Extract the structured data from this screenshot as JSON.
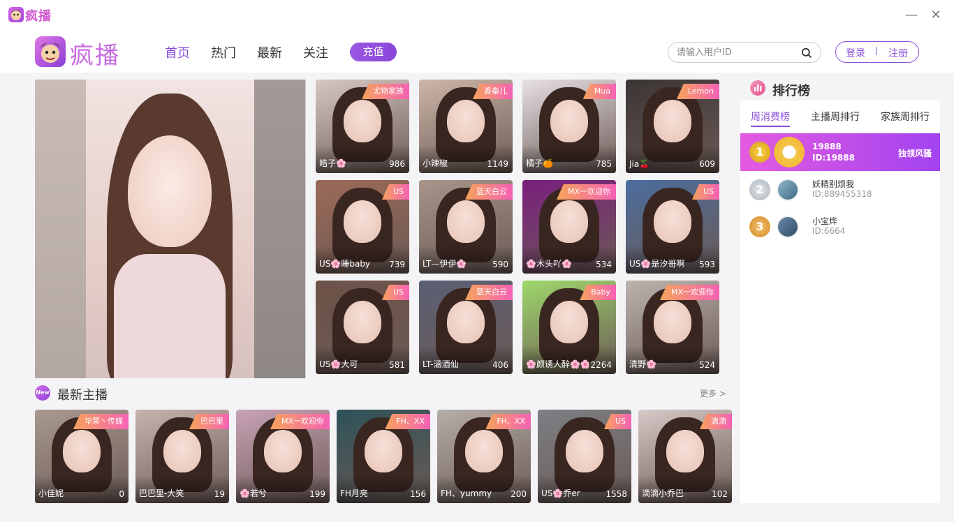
{
  "window": {
    "title": "疯播",
    "minimize_glyph": "—",
    "close_glyph": "✕"
  },
  "header": {
    "logo_text": "疯播",
    "nav": [
      {
        "label": "首页",
        "active": true
      },
      {
        "label": "热门",
        "active": false
      },
      {
        "label": "最新",
        "active": false
      },
      {
        "label": "关注",
        "active": false
      }
    ],
    "charge_label": "充值",
    "search_placeholder": "请输入用户ID",
    "login_label": "登录",
    "register_label": "注册"
  },
  "featured_grid": [
    {
      "tag": "尤物家族",
      "name": "皓子🌸",
      "count": "986",
      "bg": "#d8c8c4"
    },
    {
      "tag": "香秦儿",
      "name": "小辣椒",
      "count": "1149",
      "bg": "#cdb6a8"
    },
    {
      "tag": "Mua",
      "name": "橘子🍊",
      "count": "785",
      "bg": "#e7e0e4"
    },
    {
      "tag": "Lemon",
      "name": "Jia🍒",
      "count": "609",
      "bg": "#3b3535"
    },
    {
      "tag": "US",
      "name": "US🌸睡baby",
      "count": "739",
      "bg": "#9c6a58"
    },
    {
      "tag": "蓝天白云",
      "name": "LT—伊伊🌸",
      "count": "590",
      "bg": "#a8958a"
    },
    {
      "tag": "MX一欢迎你",
      "name": "🌸木头吖🌸",
      "count": "534",
      "bg": "#7a1f7d"
    },
    {
      "tag": "US",
      "name": "US🌸是汐哥啊",
      "count": "593",
      "bg": "#4b6d9e"
    },
    {
      "tag": "US",
      "name": "US🌸大可",
      "count": "581",
      "bg": "#6d5248"
    },
    {
      "tag": "蓝天白云",
      "name": "LT-涵酒仙",
      "count": "406",
      "bg": "#5a5f74"
    },
    {
      "tag": "Baby",
      "name": "🌸颜诱人醉🌸🌸",
      "count": "2264",
      "bg": "#9fd86c"
    },
    {
      "tag": "MX一欢迎你",
      "name": "清野🌸",
      "count": "524",
      "bg": "#bcb3ae"
    }
  ],
  "new_section": {
    "title": "最新主播",
    "icon_text": "New",
    "more_label": "更多 >"
  },
  "new_anchors": [
    {
      "tag": "华荣丶传媒",
      "name": "小佳妮",
      "count": "0",
      "bg": "#a99a90"
    },
    {
      "tag": "巴巴里",
      "name": "巴巴里-大笑",
      "count": "19",
      "bg": "#c8b3ae"
    },
    {
      "tag": "MX一欢迎你",
      "name": "🌸若兮",
      "count": "199",
      "bg": "#c9a3b6"
    },
    {
      "tag": "FH、XX",
      "name": "FH月亮",
      "count": "156",
      "bg": "#2e5258"
    },
    {
      "tag": "FH、XX",
      "name": "FH、yummy",
      "count": "200",
      "bg": "#b6aea9"
    },
    {
      "tag": "US",
      "name": "US🌸乔er",
      "count": "1558",
      "bg": "#7d7f84"
    },
    {
      "tag": "滴滴",
      "name": "滴滴小乔巴",
      "count": "102",
      "bg": "#d7c9c7"
    }
  ],
  "ranking": {
    "title": "排行榜",
    "tabs": [
      {
        "label": "周消费榜",
        "active": true
      },
      {
        "label": "主播周排行",
        "active": false
      },
      {
        "label": "家族周排行",
        "active": false
      }
    ],
    "rows": [
      {
        "rank": "1",
        "name": "19888",
        "id": "ID:19888",
        "badge": "独领风骚"
      },
      {
        "rank": "2",
        "name": "妖精别烦我",
        "id": "ID:889455318",
        "badge": ""
      },
      {
        "rank": "3",
        "name": "小宝烨",
        "id": "ID:6664",
        "badge": ""
      }
    ]
  }
}
